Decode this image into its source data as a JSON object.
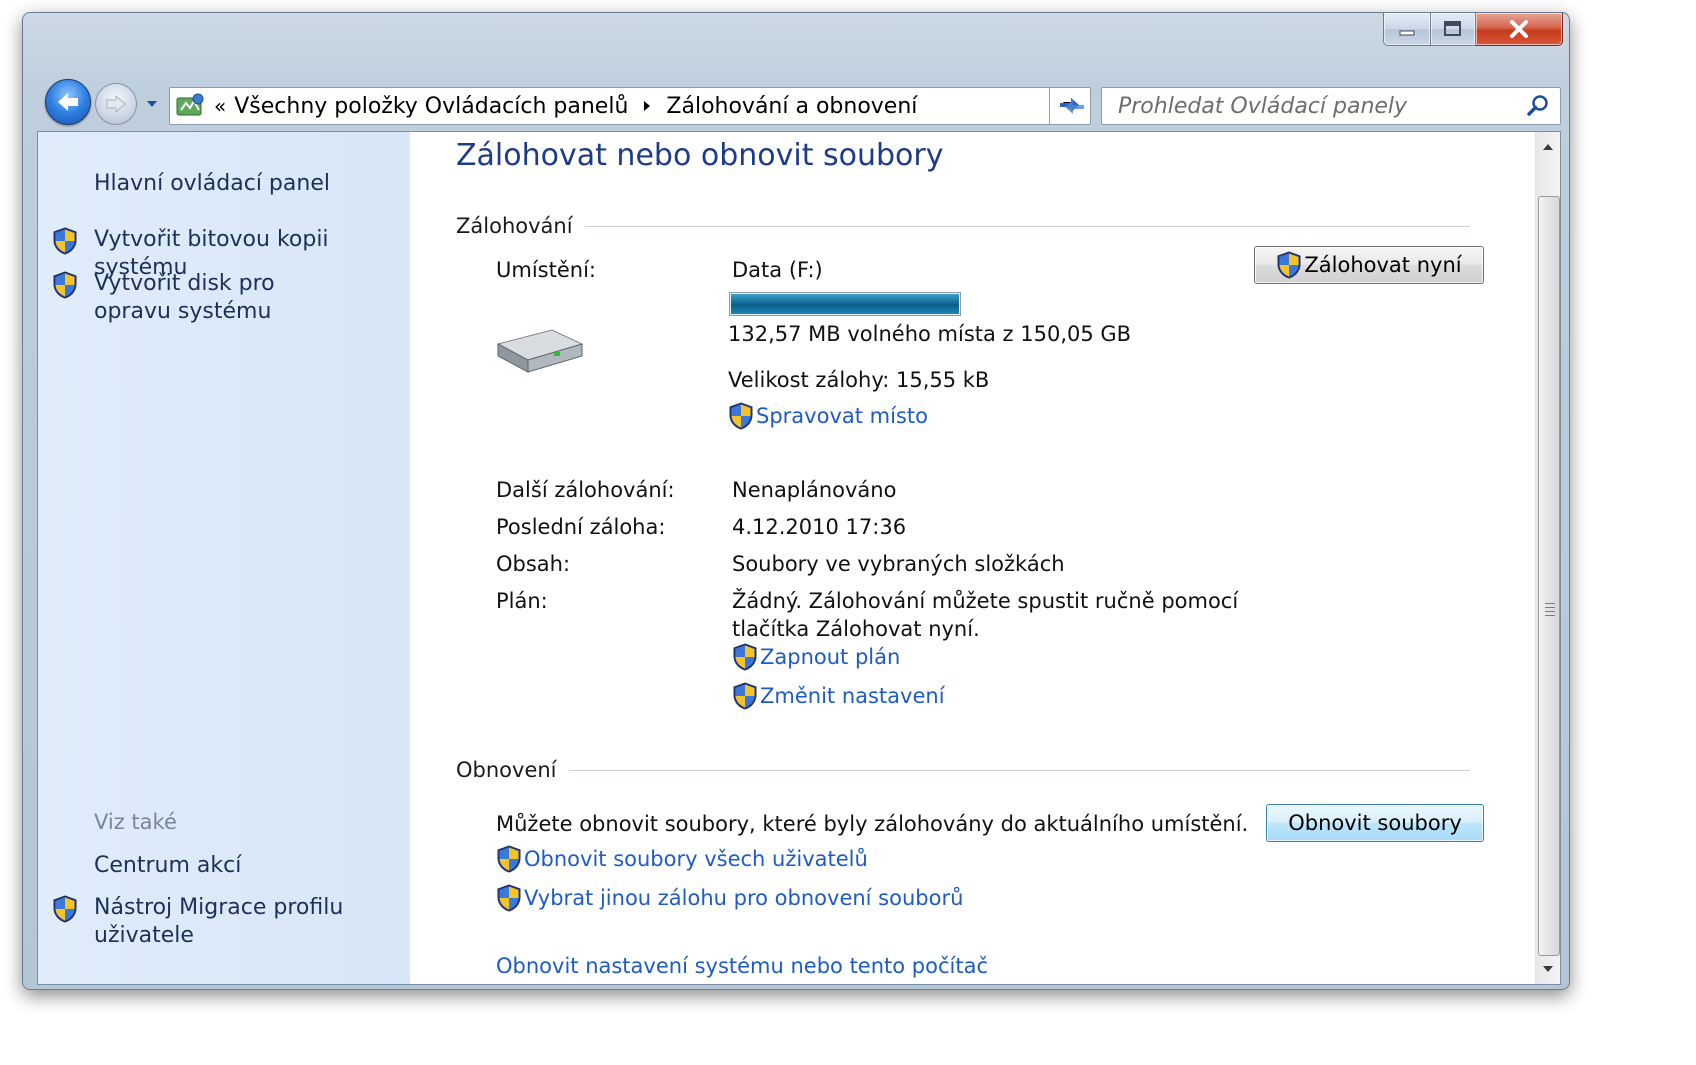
{
  "window": {
    "caption_buttons": {
      "minimize_icon": "minimize-icon",
      "maximize_icon": "maximize-icon",
      "close_icon": "close-icon"
    }
  },
  "navbar": {
    "breadcrumb_prefix": "«",
    "breadcrumbs": [
      "Všechny položky Ovládacích panelů",
      "Zálohování a obnovení"
    ],
    "search_placeholder": "Prohledat Ovládací panely"
  },
  "sidebar": {
    "home_link": "Hlavní ovládací panel",
    "tasks": [
      "Vytvořit bitovou kopii systému",
      "Vytvořit disk pro opravu systému"
    ],
    "see_also_title": "Viz také",
    "see_also": [
      "Centrum akcí",
      "Nástroj Migrace profilu uživatele"
    ]
  },
  "main": {
    "title": "Zálohovat nebo obnovit soubory",
    "backup": {
      "header": "Zálohování",
      "location_label": "Umístění:",
      "location_value": "Data (F:)",
      "disk_used_fraction": 0.999,
      "free_space": "132,57 MB volného místa z 150,05 GB",
      "backup_size": "Velikost zálohy: 15,55 kB",
      "manage_space_link": "Spravovat místo",
      "backup_now_button": "Zálohovat nyní",
      "next_label": "Další zálohování:",
      "next_value": "Nenaplánováno",
      "last_label": "Poslední záloha:",
      "last_value": "4.12.2010 17:36",
      "contents_label": "Obsah:",
      "contents_value": "Soubory ve vybraných složkách",
      "schedule_label": "Plán:",
      "schedule_value_line1": "Žádný. Zálohování můžete spustit ručně pomocí",
      "schedule_value_line2": "tlačítka Zálohovat nyní.",
      "turn_on_schedule_link": "Zapnout plán",
      "change_settings_link": "Změnit nastavení"
    },
    "restore": {
      "header": "Obnovení",
      "description": "Můžete obnovit soubory, které byly zálohovány do aktuálního umístění.",
      "restore_button": "Obnovit soubory",
      "restore_all_users_link": "Obnovit soubory všech uživatelů",
      "select_other_backup_link": "Vybrat jinou zálohu pro obnovení souborů",
      "recover_system_link": "Obnovit nastavení systému nebo tento počítač"
    }
  },
  "colors": {
    "link": "#1e5bc6",
    "title": "#1e3b8a",
    "sidebar_bg": "#dae8f8"
  }
}
